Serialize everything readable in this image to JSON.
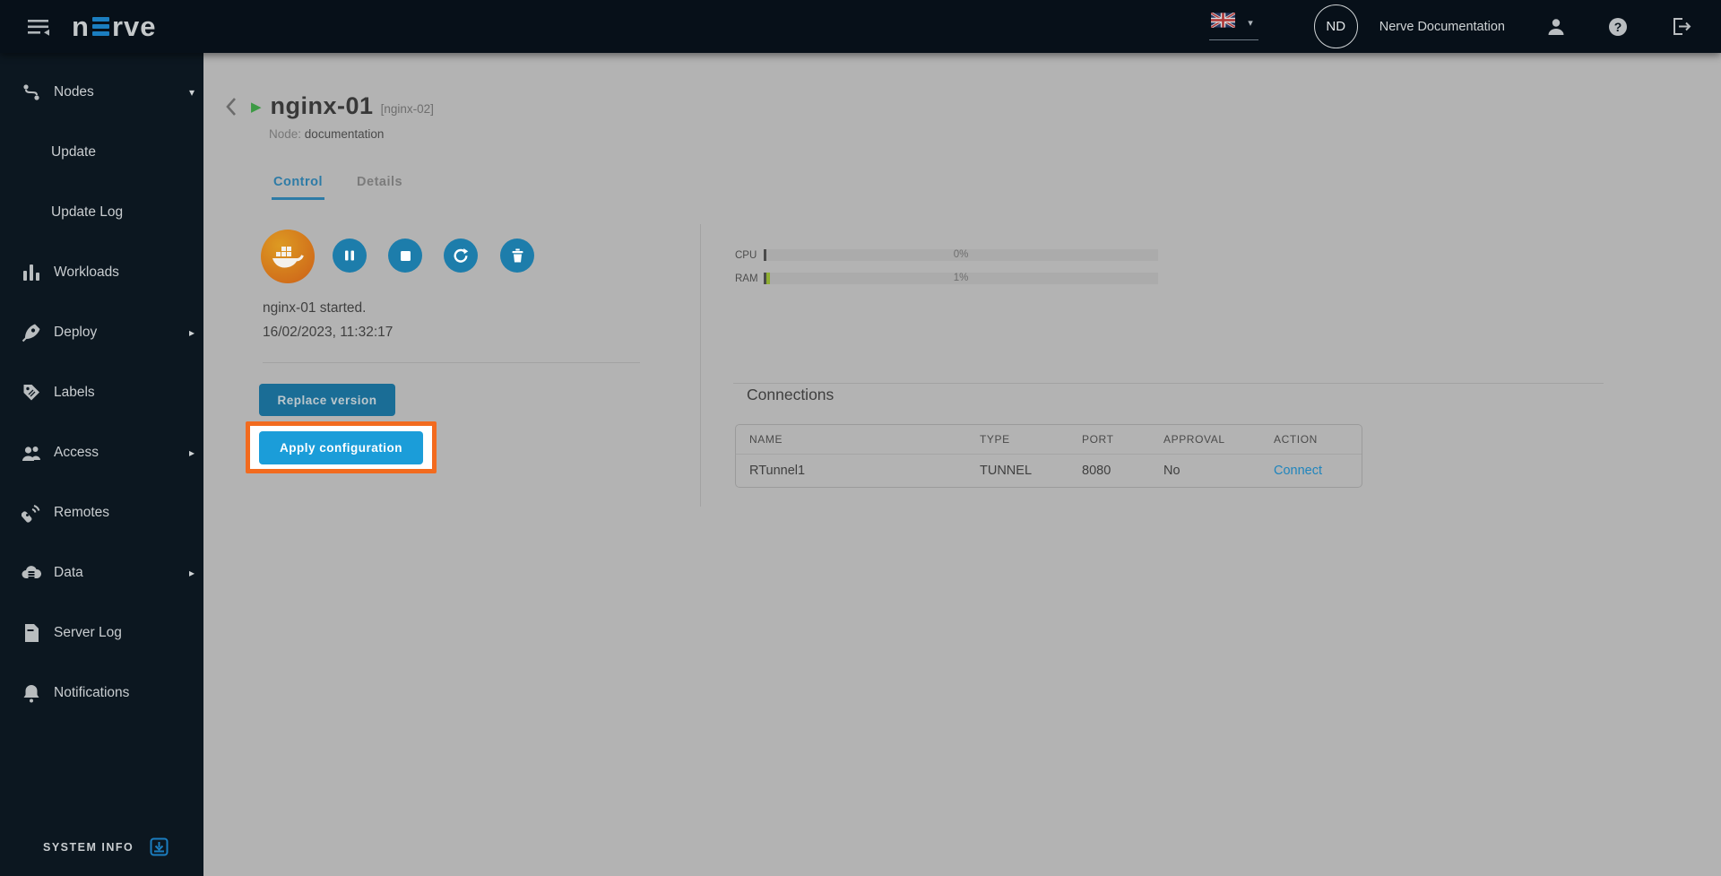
{
  "topbar": {
    "user_initials": "ND",
    "user_name": "Nerve Documentation",
    "logo_n": "n",
    "logo_rve": "rve"
  },
  "sidebar": {
    "items": [
      {
        "label": "Nodes",
        "caret": "▾"
      },
      {
        "label": "Update"
      },
      {
        "label": "Update Log"
      },
      {
        "label": "Workloads"
      },
      {
        "label": "Deploy",
        "caret": "▸"
      },
      {
        "label": "Labels"
      },
      {
        "label": "Access",
        "caret": "▸"
      },
      {
        "label": "Remotes"
      },
      {
        "label": "Data",
        "caret": "▸"
      },
      {
        "label": "Server Log"
      },
      {
        "label": "Notifications"
      }
    ],
    "system_info_label": "SYSTEM INFO"
  },
  "header": {
    "title": "nginx-01",
    "version_badge": "[nginx-02]",
    "node_label": "Node:",
    "node_name": "documentation"
  },
  "tabs": {
    "control": "Control",
    "details": "Details"
  },
  "control_panel": {
    "status": "nginx-01 started.",
    "timestamp": "16/02/2023, 11:32:17",
    "replace_version_label": "Replace version",
    "apply_configuration_label": "Apply configuration"
  },
  "metrics": {
    "cpu_label": "CPU",
    "cpu_value": "0%",
    "cpu_percent": 0,
    "ram_label": "RAM",
    "ram_value": "1%",
    "ram_percent": 1
  },
  "connections": {
    "title": "Connections",
    "headers": [
      "NAME",
      "TYPE",
      "PORT",
      "APPROVAL",
      "ACTION"
    ],
    "rows": [
      {
        "name": "RTunnel1",
        "type": "TUNNEL",
        "port": "8080",
        "approval": "No",
        "action": "Connect"
      }
    ]
  },
  "colors": {
    "accent_blue": "#1b9dd9",
    "highlight_orange": "#f26b1f",
    "ram_green": "#8fae33",
    "logo_blue": "#1b7ec0",
    "link_blue": "#1f85bd",
    "topbar_bg": "#071019",
    "sidebar_bg": "#0c1720",
    "main_bg": "#b3b3b3"
  }
}
